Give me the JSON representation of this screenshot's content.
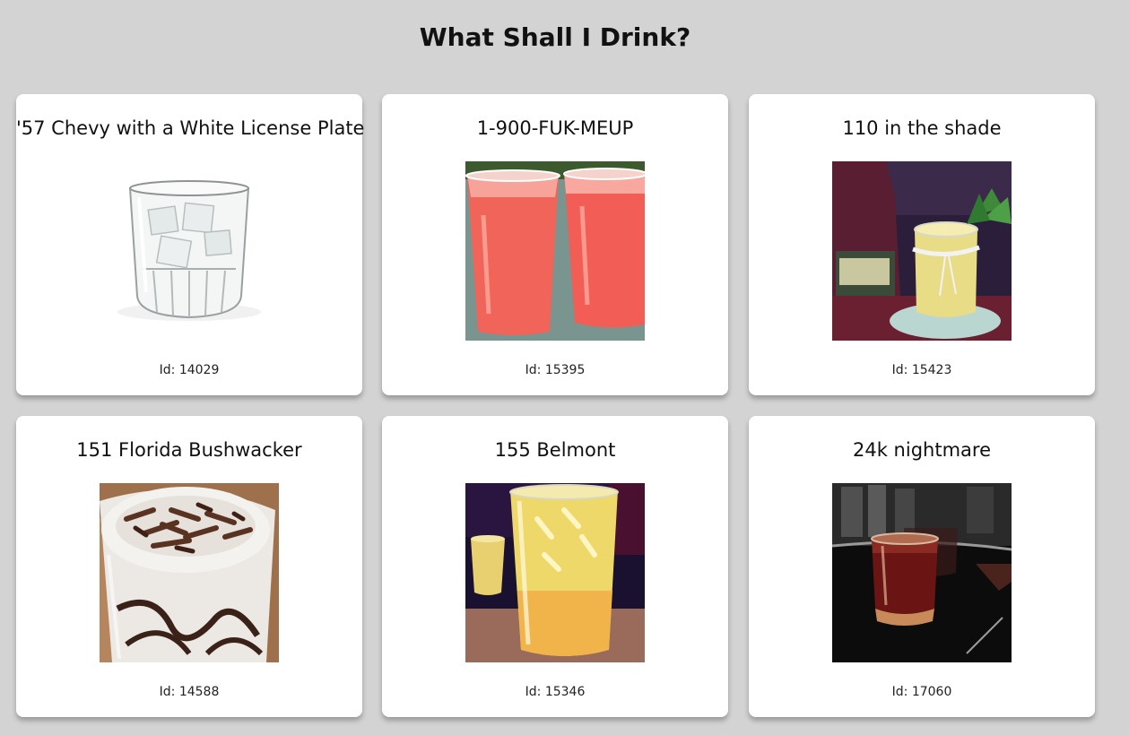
{
  "header": {
    "title": "What Shall I Drink?"
  },
  "drinks": [
    {
      "name": "'57 Chevy with a White License Plate",
      "id_text": "Id: 14029",
      "image": "ice-glass-image"
    },
    {
      "name": "1-900-FUK-MEUP",
      "id_text": "Id: 15395",
      "image": "red-cocktail-cups-image"
    },
    {
      "name": "110 in the shade",
      "id_text": "Id: 15423",
      "image": "yellow-cocktail-jar-image"
    },
    {
      "name": "151 Florida Bushwacker",
      "id_text": "Id: 14588",
      "image": "chocolate-shake-image"
    },
    {
      "name": "155 Belmont",
      "id_text": "Id: 15346",
      "image": "orange-cocktail-glass-image"
    },
    {
      "name": "24k nightmare",
      "id_text": "Id: 17060",
      "image": "dark-shot-glass-image"
    }
  ]
}
